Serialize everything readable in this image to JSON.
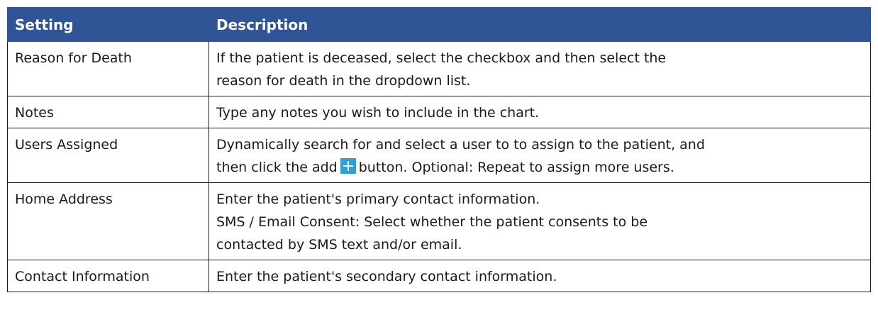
{
  "table": {
    "headers": {
      "setting": "Setting",
      "description": "Description"
    },
    "rows": [
      {
        "setting": "Reason for Death",
        "description_lines": [
          "If the patient is deceased, select the checkbox and then select the",
          "reason for death in the dropdown list."
        ]
      },
      {
        "setting": "Notes",
        "description_lines": [
          "Type any notes you wish to include in the chart."
        ]
      },
      {
        "setting": "Users Assigned",
        "description_line1": "Dynamically search for and select a user to to assign to the patient, and",
        "description_line2_before_icon": "then click the add",
        "description_line2_after_icon": "button. Optional: Repeat to assign more users.",
        "icon": "add-icon"
      },
      {
        "setting": "Home Address",
        "description_lines": [
          "Enter the patient's primary contact information.",
          "SMS / Email Consent: Select whether the patient consents to be",
          "contacted by SMS text and/or email."
        ]
      },
      {
        "setting": "Contact Information",
        "description_lines": [
          "Enter the patient's secondary contact information."
        ]
      }
    ]
  },
  "colors": {
    "header_background": "#2f5597",
    "header_text": "#ffffff",
    "add_icon": "#2f9fd8"
  }
}
